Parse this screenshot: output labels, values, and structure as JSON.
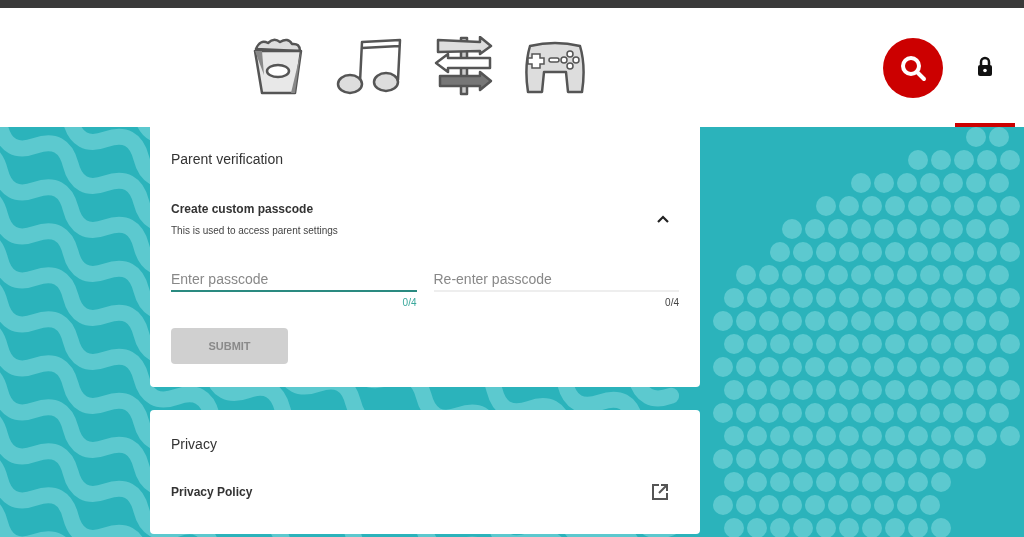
{
  "nav_tabs": [
    {
      "kind": "popcorn",
      "selected": false
    },
    {
      "kind": "music",
      "selected": false
    },
    {
      "kind": "signpost",
      "selected": false
    },
    {
      "kind": "gamepad",
      "selected": false
    }
  ],
  "search": {
    "kind": "search"
  },
  "lock_tab": {
    "selected": true
  },
  "parent_verification": {
    "title": "Parent verification",
    "section": {
      "title": "Create custom passcode",
      "subtitle": "This is used to access parent settings",
      "expanded": true
    },
    "fields": [
      {
        "placeholder": "Enter passcode",
        "counter": "0/4",
        "focused": true
      },
      {
        "placeholder": "Re-enter passcode",
        "counter": "0/4",
        "focused": false
      }
    ],
    "submit": {
      "label": "SUBMIT",
      "disabled": true
    }
  },
  "privacy": {
    "title": "Privacy",
    "items": [
      {
        "label": "Privacy Policy"
      }
    ]
  }
}
